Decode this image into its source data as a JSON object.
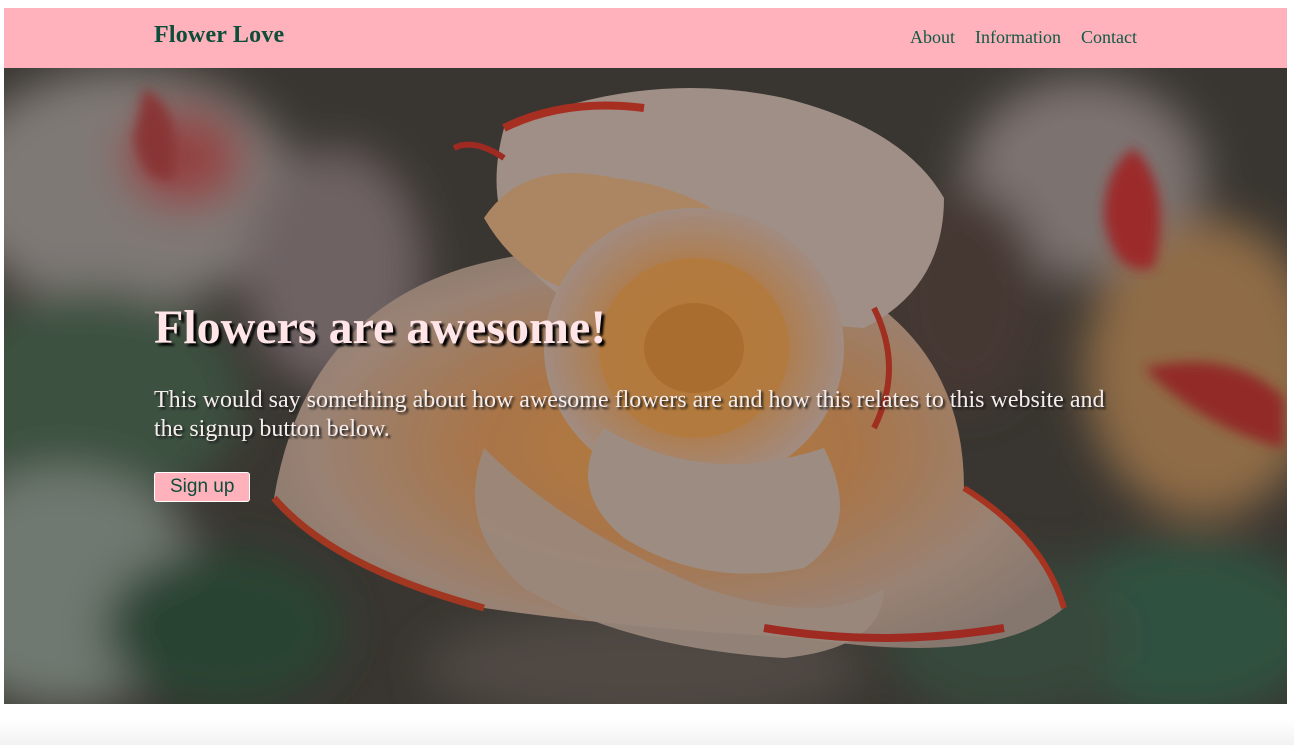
{
  "header": {
    "brand": "Flower Love",
    "nav": [
      "About",
      "Information",
      "Contact"
    ]
  },
  "hero": {
    "title": "Flowers are awesome!",
    "text": "This would say something about how awesome flowers are and how this relates to this website and the signup button below.",
    "button_label": "Sign up",
    "image": "rose-photo"
  },
  "colors": {
    "header_bg": "#ffb1bc",
    "brand_text": "#0d4d3a",
    "button_bg": "#ffb1bc"
  }
}
